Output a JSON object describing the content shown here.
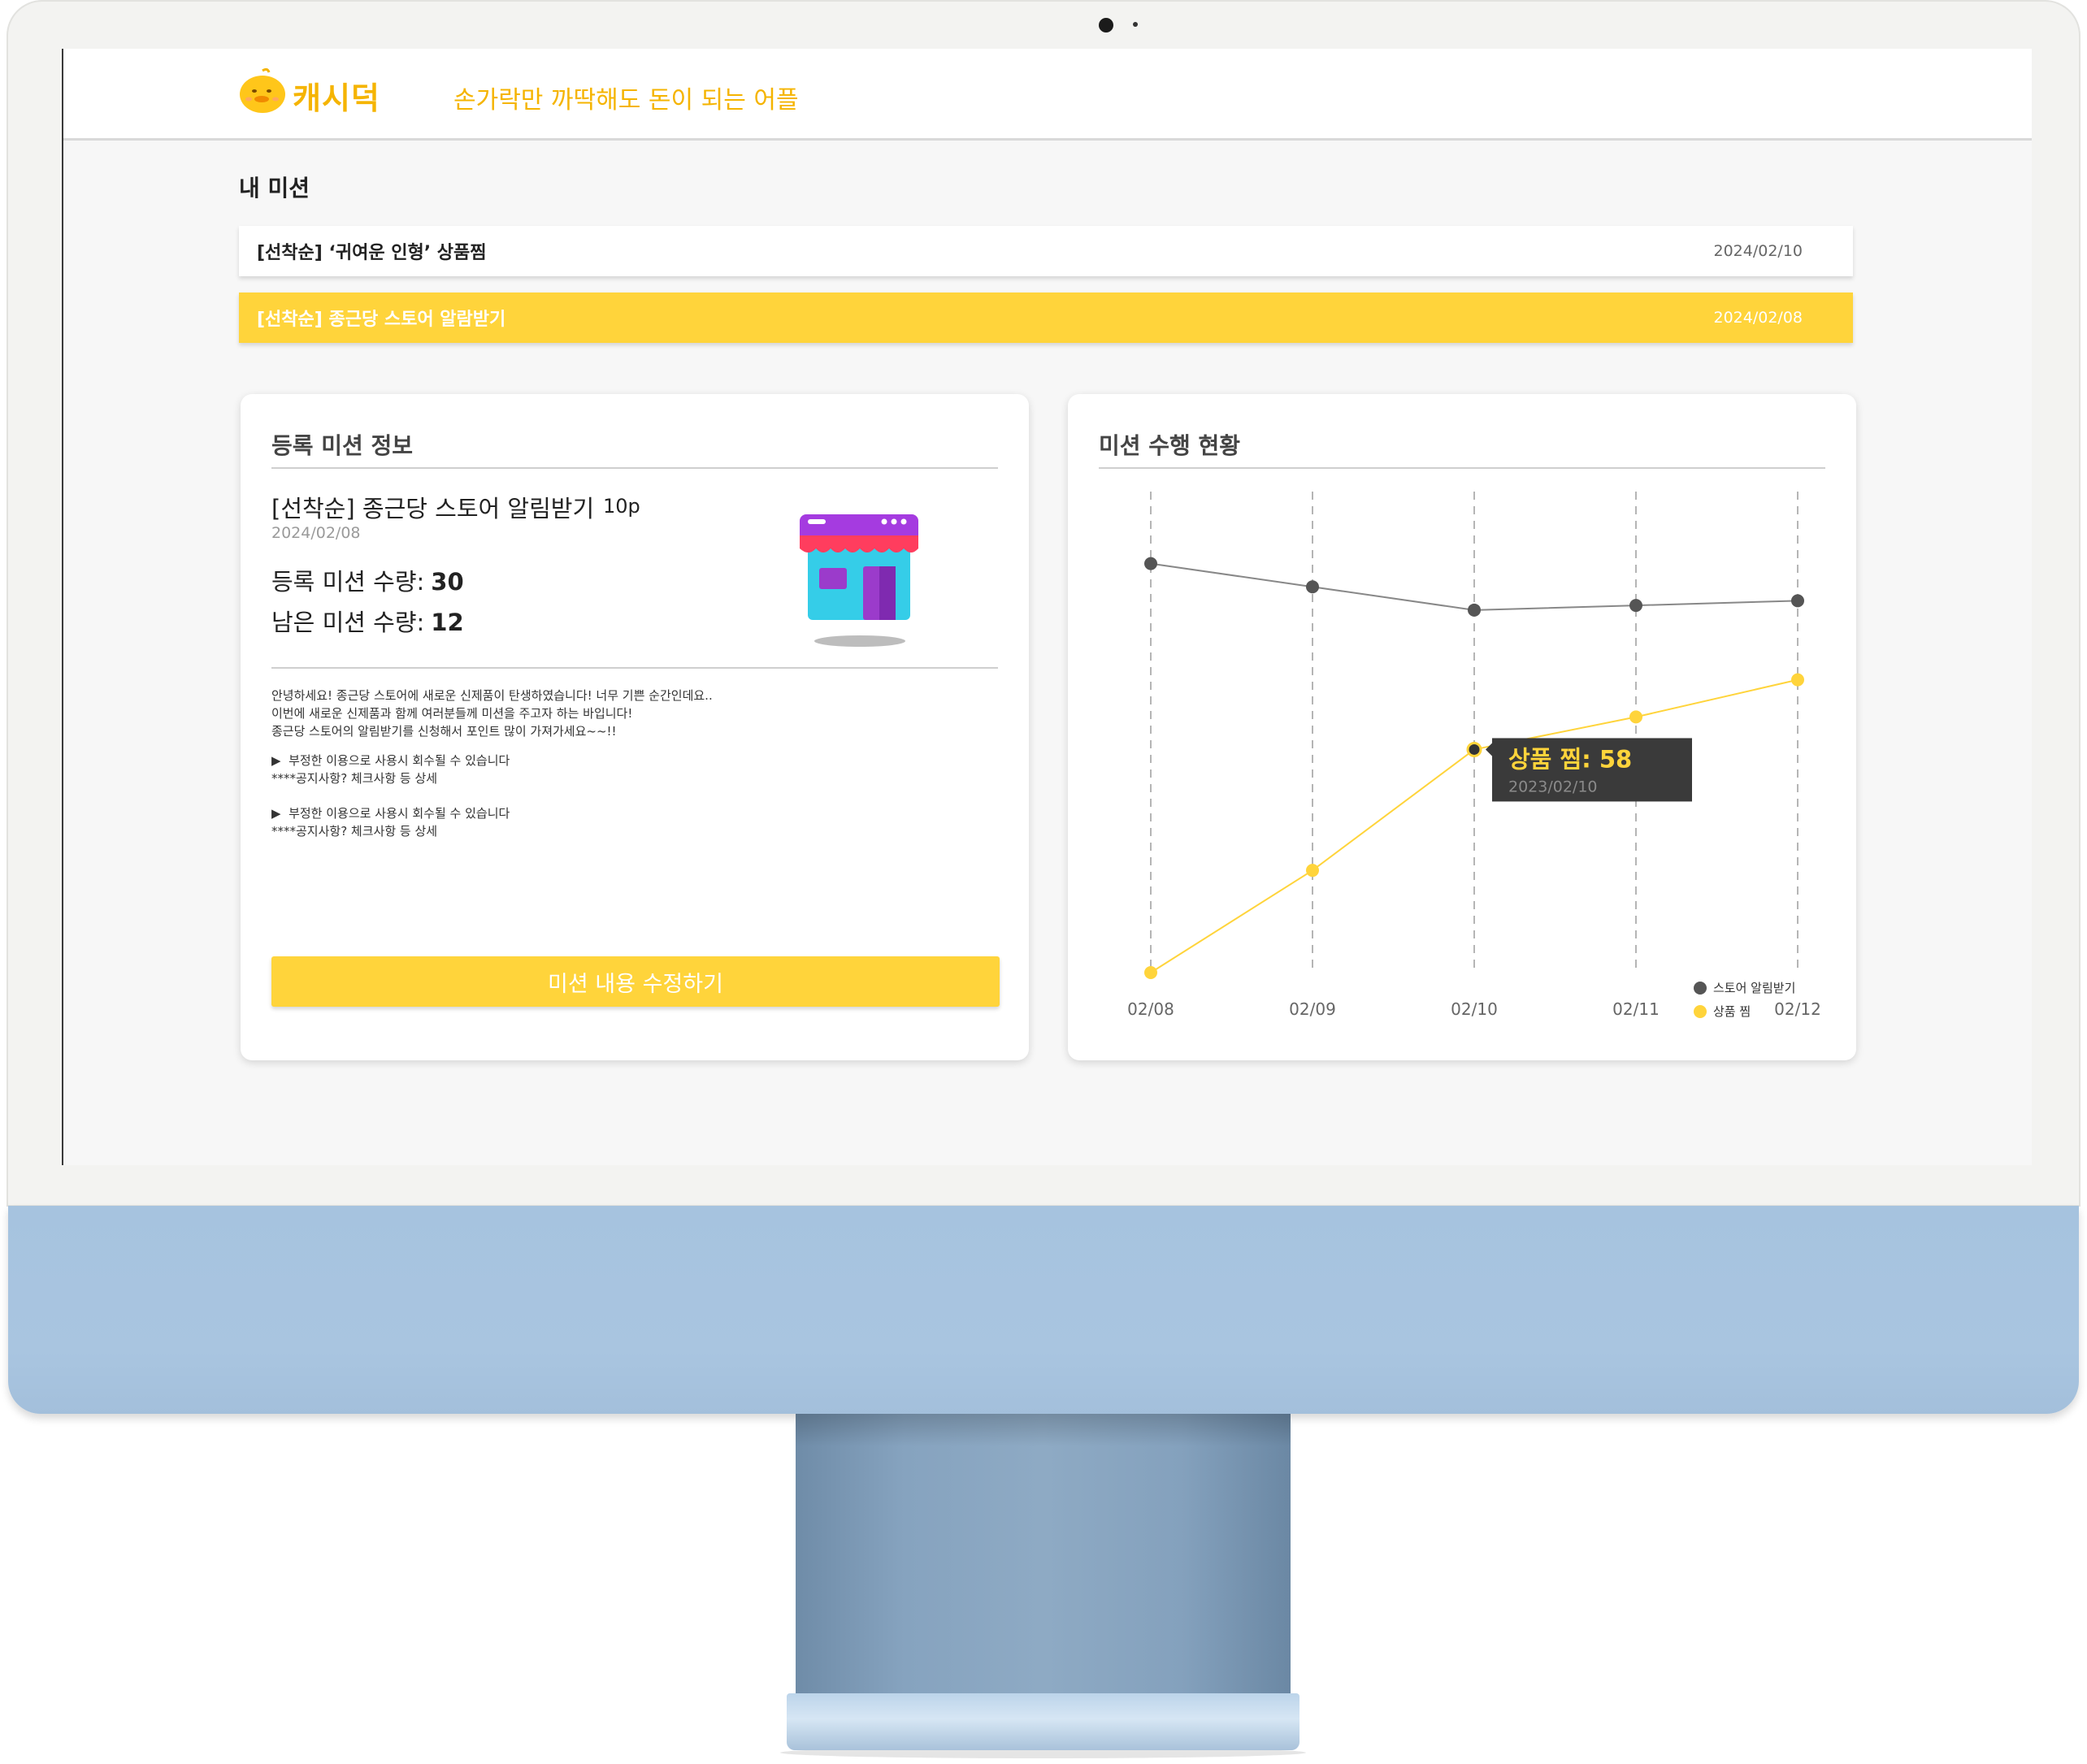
{
  "app": {
    "name": "캐시덕",
    "tagline": "손가락만 까딱해도 돈이 되는 어플"
  },
  "my_missions": {
    "title": "내 미션",
    "items": [
      {
        "label": "[선착순] ‘귀여운 인형’ 상품찜",
        "date": "2024/02/10",
        "selected": false
      },
      {
        "label": "[선착순] 종근당 스토어 알람받기",
        "date": "2024/02/08",
        "selected": true
      }
    ]
  },
  "mission_info": {
    "title": "등록 미션 정보",
    "name": "[선착순] 종근당 스토어 알림받기",
    "point": "10p",
    "date": "2024/02/08",
    "registered_label": "등록 미션 수량:",
    "registered_value": "30",
    "remaining_label": "남은 미션 수량:",
    "remaining_value": "12",
    "description": "안녕하세요! 종근당 스토어에 새로운 신제품이 탄생하였습니다! 너무 기쁜 순간인데요..\n이번에 새로운 신제품과 함께 여러분들께 미션을 주고자 하는 바입니다!\n종근당 스토어의 알림받기를 신청해서 포인트 많이 가져가세요~~!!",
    "notice_1": "▶  부정한 이용으로 사용시 회수될 수 있습니다\n****공지사항? 체크사항 등 상세",
    "notice_2": "▶  부정한 이용으로 사용시 회수될 수 있습니다\n****공지사항? 체크사항 등 상세",
    "edit_button": "미션 내용 수정하기"
  },
  "status_card": {
    "title": "미션 수행 현황",
    "tooltip": {
      "value": "상품 찜: 58",
      "date": "2023/02/10"
    }
  },
  "colors": {
    "accent": "#ffd43b",
    "brand": "#f5b400",
    "series_dark": "#555555",
    "series_yellow": "#ffd43b"
  },
  "chart_data": {
    "type": "line",
    "categories": [
      "02/08",
      "02/09",
      "02/10",
      "02/11",
      "02/12"
    ],
    "ylim": [
      0,
      100
    ],
    "series": [
      {
        "name": "스토어 알림받기",
        "color": "#555555",
        "values": [
          88,
          83,
          78,
          79,
          80
        ]
      },
      {
        "name": "상품 찜",
        "color": "#ffd43b",
        "values": [
          0,
          22,
          48,
          55,
          63
        ]
      }
    ],
    "grid": "vertical dashed",
    "legend": "bottom-right"
  }
}
